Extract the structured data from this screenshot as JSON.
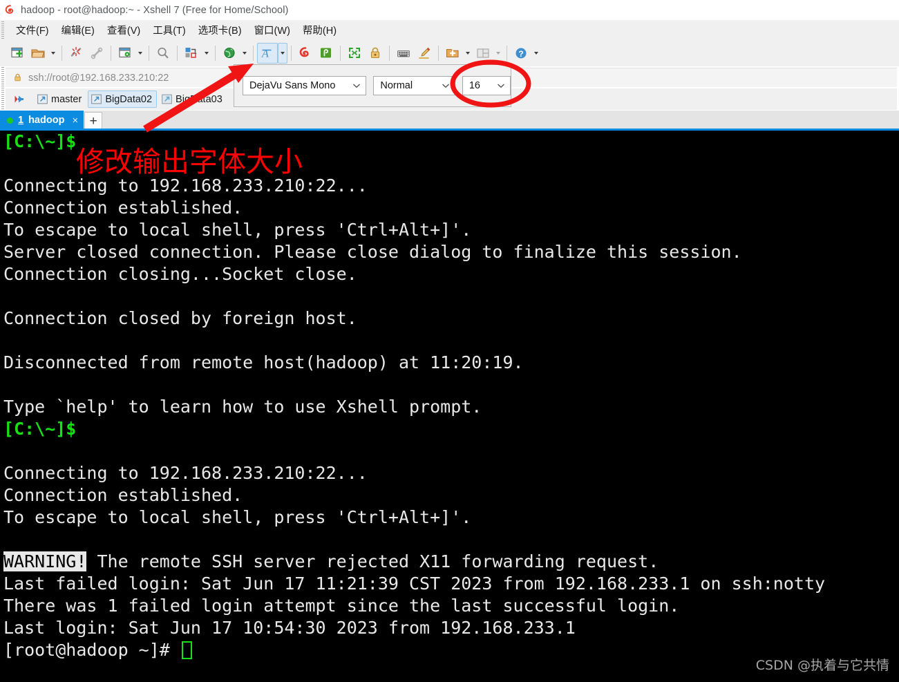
{
  "window": {
    "title": "hadoop - root@hadoop:~ - Xshell 7 (Free for Home/School)",
    "app_icon": "xshell-logo-icon"
  },
  "menubar": {
    "items": [
      {
        "label": "文件(F)",
        "name": "menu-file"
      },
      {
        "label": "编辑(E)",
        "name": "menu-edit"
      },
      {
        "label": "查看(V)",
        "name": "menu-view"
      },
      {
        "label": "工具(T)",
        "name": "menu-tools"
      },
      {
        "label": "选项卡(B)",
        "name": "menu-tabs"
      },
      {
        "label": "窗口(W)",
        "name": "menu-window"
      },
      {
        "label": "帮助(H)",
        "name": "menu-help"
      }
    ]
  },
  "toolbar": {
    "buttons": [
      {
        "icon": "new-session-icon",
        "name": "new-session-button",
        "caret": false
      },
      {
        "icon": "open-folder-icon",
        "name": "open-session-button",
        "caret": true
      },
      {
        "icon": "disconnect-icon",
        "name": "disconnect-button",
        "caret": false
      },
      {
        "icon": "reconnect-icon",
        "name": "reconnect-button",
        "caret": false
      },
      {
        "icon": "properties-icon",
        "name": "session-properties-button",
        "caret": true
      },
      {
        "icon": "find-icon",
        "name": "find-button",
        "caret": false
      },
      {
        "icon": "transfer-icon",
        "name": "file-transfer-button",
        "caret": true
      },
      {
        "icon": "globe-icon",
        "name": "encoding-button",
        "caret": true
      },
      {
        "icon": "font-icon",
        "name": "font-button",
        "caret": true,
        "active": true
      },
      {
        "icon": "xshell-icon",
        "name": "open-xshell-button",
        "caret": false
      },
      {
        "icon": "xftp-icon",
        "name": "open-xftp-button",
        "caret": false
      },
      {
        "icon": "fullscreen-icon",
        "name": "fullscreen-button",
        "caret": false
      },
      {
        "icon": "lock-icon",
        "name": "lock-button",
        "caret": false
      },
      {
        "icon": "keyboard-icon",
        "name": "compose-bar-button",
        "caret": false
      },
      {
        "icon": "highlight-pen-icon",
        "name": "highlight-button",
        "caret": false
      },
      {
        "icon": "add-folder-icon",
        "name": "new-folder-button",
        "caret": true
      },
      {
        "icon": "split-layout-icon",
        "name": "arrange-layout-button",
        "caret": true
      },
      {
        "icon": "help-icon",
        "name": "help-button",
        "caret": false
      }
    ]
  },
  "address_bar": {
    "icon": "lock-icon",
    "value": "ssh://root@192.168.233.210:22"
  },
  "bookmark_bar": {
    "items": [
      {
        "label": "",
        "icon": "red-arrow-icon",
        "name": "bookmark-arrow",
        "selected": false
      },
      {
        "label": "master",
        "icon": "session-icon",
        "name": "bookmark-master",
        "selected": false
      },
      {
        "label": "BigData02",
        "icon": "session-icon",
        "name": "bookmark-bigdata02",
        "selected": true
      },
      {
        "label": "BigData03",
        "icon": "session-icon",
        "name": "bookmark-bigdata03",
        "selected": false
      }
    ]
  },
  "tabs": {
    "items": [
      {
        "number": "1",
        "title": "hadoop",
        "status": "connected",
        "close_glyph": "×"
      }
    ],
    "new_tab_glyph": "+"
  },
  "font_panel": {
    "family": {
      "value": "DejaVu Sans Mono",
      "arrow": "chevron-down-icon"
    },
    "style": {
      "value": "Normal",
      "arrow": "chevron-down-icon"
    },
    "size": {
      "value": "16",
      "arrow": "chevron-down-icon"
    }
  },
  "annotations": {
    "note_text": "修改输出字体大小",
    "note_color": "#fe0000",
    "arrow": {
      "name": "red-arrow-annotation",
      "color": "#fe0000"
    },
    "ellipse": {
      "name": "red-ellipse-annotation",
      "color": "#fe0000"
    }
  },
  "terminal": {
    "background": "#000000",
    "foreground": "#e8e8e8",
    "prompt_color": "#18e018",
    "cursor_color": "#18e018",
    "lines": [
      {
        "t": "[C:\\~]$",
        "k": "prompt"
      },
      {
        "t": "",
        "k": "normal"
      },
      {
        "t": "Connecting to 192.168.233.210:22...",
        "k": "normal"
      },
      {
        "t": "Connection established.",
        "k": "normal"
      },
      {
        "t": "To escape to local shell, press 'Ctrl+Alt+]'.",
        "k": "normal"
      },
      {
        "t": "Server closed connection. Please close dialog to finalize this session.",
        "k": "normal"
      },
      {
        "t": "Connection closing...Socket close.",
        "k": "normal"
      },
      {
        "t": "",
        "k": "normal"
      },
      {
        "t": "Connection closed by foreign host.",
        "k": "normal"
      },
      {
        "t": "",
        "k": "normal"
      },
      {
        "t": "Disconnected from remote host(hadoop) at 11:20:19.",
        "k": "normal"
      },
      {
        "t": "",
        "k": "normal"
      },
      {
        "t": "Type `help' to learn how to use Xshell prompt.",
        "k": "normal"
      },
      {
        "t": "[C:\\~]$",
        "k": "prompt"
      },
      {
        "t": "",
        "k": "normal"
      },
      {
        "t": "Connecting to 192.168.233.210:22...",
        "k": "normal"
      },
      {
        "t": "Connection established.",
        "k": "normal"
      },
      {
        "t": "To escape to local shell, press 'Ctrl+Alt+]'.",
        "k": "normal"
      },
      {
        "t": "",
        "k": "normal"
      },
      {
        "t": "WARNING!",
        "k": "inverse",
        "rest": " The remote SSH server rejected X11 forwarding request."
      },
      {
        "t": "Last failed login: Sat Jun 17 11:21:39 CST 2023 from 192.168.233.1 on ssh:notty",
        "k": "normal"
      },
      {
        "t": "There was 1 failed login attempt since the last successful login.",
        "k": "normal"
      },
      {
        "t": "Last login: Sat Jun 17 10:54:30 2023 from 192.168.233.1",
        "k": "normal"
      },
      {
        "t": "[root@hadoop ~]# ",
        "k": "cursor"
      }
    ]
  },
  "watermark": {
    "text": "CSDN @执着与它共情"
  }
}
